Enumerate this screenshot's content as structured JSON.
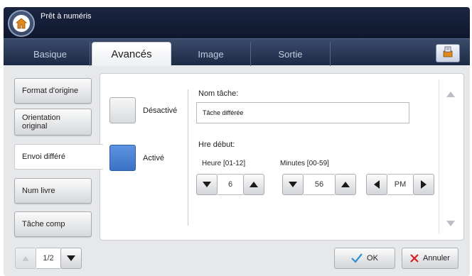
{
  "header": {
    "title": "Prêt à numéris"
  },
  "tabs": [
    {
      "label": "Basique"
    },
    {
      "label": "Avancés"
    },
    {
      "label": "Image"
    },
    {
      "label": "Sortie"
    }
  ],
  "sidebar": {
    "items": [
      {
        "label": "Format d'origine"
      },
      {
        "label_line1": "Orientation",
        "label_line2": "original"
      },
      {
        "label": "Envoi différé"
      },
      {
        "label": "Num livre"
      },
      {
        "label": "Tâche comp"
      }
    ]
  },
  "delayed_send": {
    "option_off": "Désactivé",
    "option_on": "Activé",
    "selected": "Activé",
    "job_name_label": "Nom tâche:",
    "job_name_value": "Tâche différée",
    "start_time_label": "Hre début:",
    "hour_label": "Heure [01-12]",
    "minutes_label": "Minutes [00-59]",
    "hour_value": "6",
    "minutes_value": "56",
    "ampm_value": "PM"
  },
  "pager": {
    "value": "1/2"
  },
  "actions": {
    "ok_label": "OK",
    "cancel_label": "Annuler"
  },
  "colors": {
    "accent_blue": "#4a82d4",
    "title_bg": "#14203a",
    "check_green": "#2f8fd8",
    "cancel_red": "#d62020"
  },
  "icons": {
    "home": "home-icon",
    "tab_action": "document-stack-icon",
    "ok": "checkmark-icon",
    "cancel": "x-icon"
  }
}
